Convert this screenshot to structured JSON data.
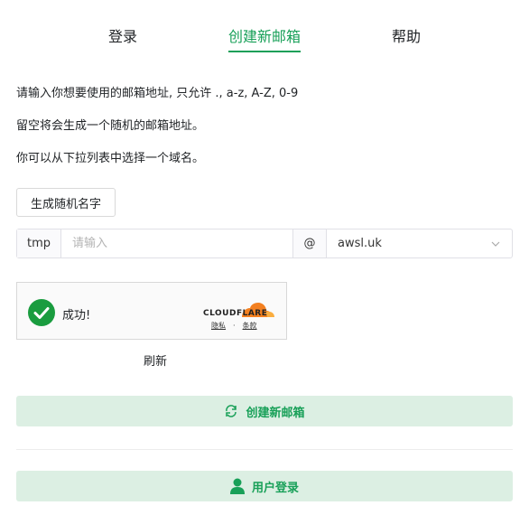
{
  "tabs": [
    {
      "label": "登录"
    },
    {
      "label": "创建新邮箱",
      "active": true
    },
    {
      "label": "帮助"
    }
  ],
  "instructions": [
    "请输入你想要使用的邮箱地址, 只允许 ., a-z, A-Z, 0-9",
    "留空将会生成一个随机的邮箱地址。",
    "你可以从下拉列表中选择一个域名。"
  ],
  "random_name_button": "生成随机名字",
  "address": {
    "prefix": "tmp",
    "placeholder": "请输入",
    "value": "",
    "at": "@",
    "domain": "awsl.uk"
  },
  "captcha": {
    "status": "成功!",
    "brand": "CLOUDFLARE",
    "privacy": "隐私",
    "separator": "·",
    "terms": "条款"
  },
  "refresh_label": "刷新",
  "create_button": "创建新邮箱",
  "login_button": "用户登录",
  "colors": {
    "accent": "#18a058",
    "button_bg": "#dcefe3",
    "cloudflare_orange": "#f38020"
  }
}
